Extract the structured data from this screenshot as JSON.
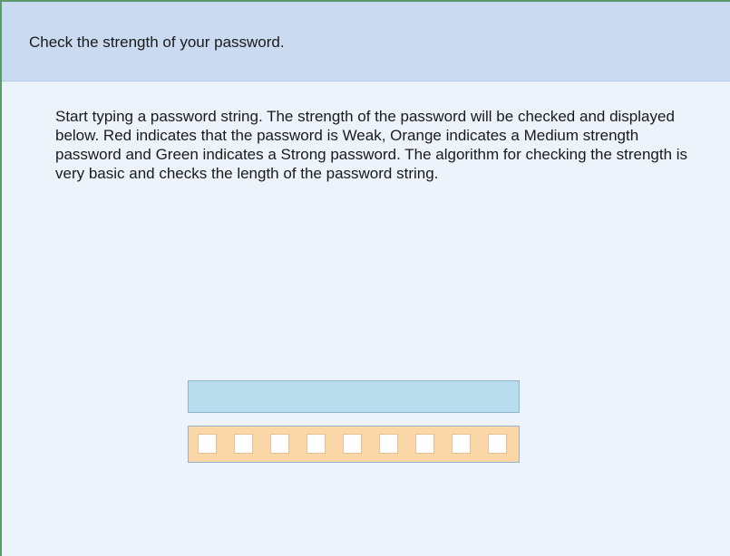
{
  "header": {
    "title": "Check the strength of your password."
  },
  "main": {
    "description": "Start typing a password string. The strength of the password will be checked and displayed below. Red indicates that the password is Weak, Orange indicates a Medium strength password and Green indicates a Strong password. The algorithm for checking the strength is very basic and checks the length of the password string.",
    "password_value": "",
    "strength_meter": {
      "segments_total": 9,
      "segments_filled": 0
    }
  },
  "colors": {
    "header_bg": "#c9daf1",
    "body_bg": "#edf3fb",
    "input_bg": "#b8deee",
    "meter_bg": "#fbd6a6",
    "weak": "red",
    "medium": "orange",
    "strong": "green"
  }
}
